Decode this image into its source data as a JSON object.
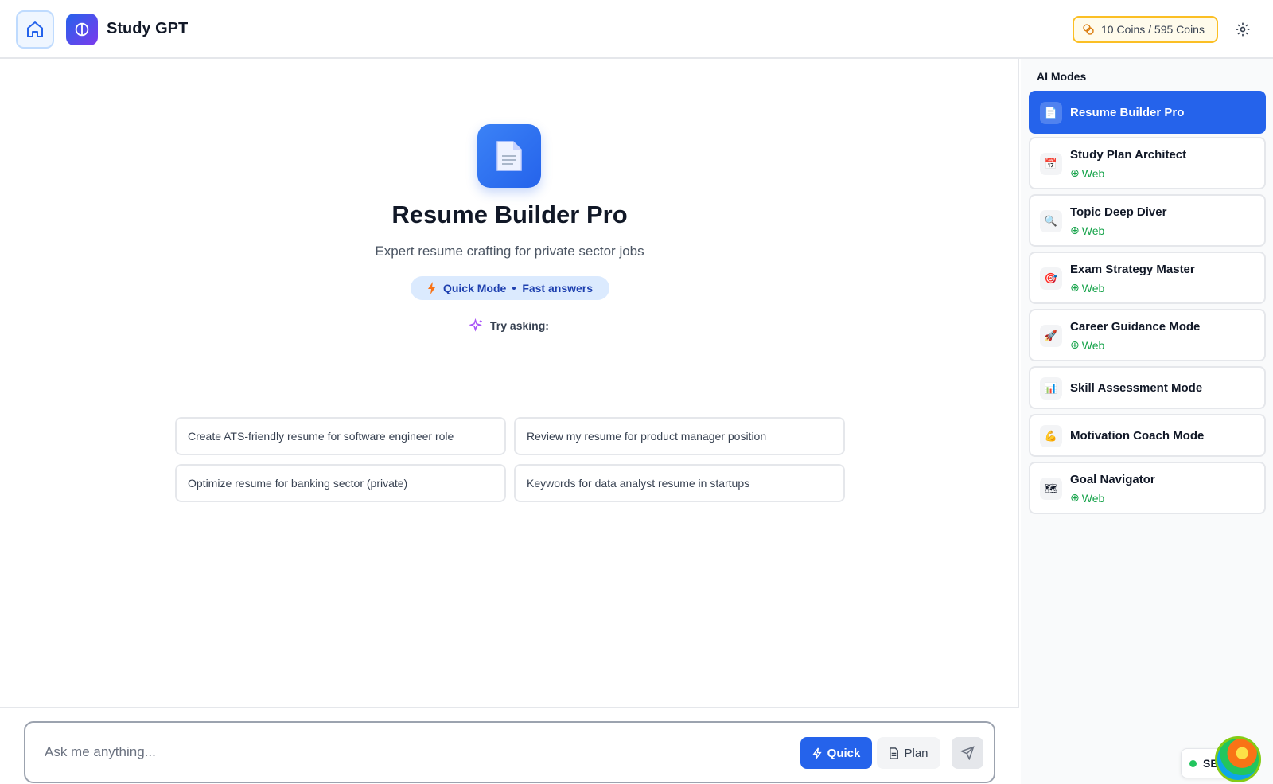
{
  "header": {
    "app_title": "Study GPT",
    "coins_label": "10 Coins / 595 Coins"
  },
  "hero": {
    "title": "Resume Builder Pro",
    "subtitle": "Expert resume crafting for private sector jobs",
    "mode_label": "Quick Mode",
    "mode_detail": "Fast answers"
  },
  "suggestions": {
    "heading": "Try asking:",
    "items": [
      "Create ATS-friendly resume for software engineer role",
      "Review my resume for product manager position",
      "Optimize resume for banking sector (private)",
      "Keywords for data analyst resume in startups"
    ]
  },
  "composer": {
    "placeholder": "Ask me anything...",
    "quick_label": "Quick",
    "plan_label": "Plan"
  },
  "sidebar": {
    "title": "AI Modes",
    "web_label": "Web",
    "modes": [
      {
        "label": "Resume Builder Pro",
        "icon": "document-icon",
        "active": true,
        "web": false
      },
      {
        "label": "Study Plan Architect",
        "icon": "calendar-icon",
        "active": false,
        "web": true
      },
      {
        "label": "Topic Deep Diver",
        "icon": "magnifier-icon",
        "active": false,
        "web": true
      },
      {
        "label": "Exam Strategy Master",
        "icon": "target-icon",
        "active": false,
        "web": true
      },
      {
        "label": "Career Guidance Mode",
        "icon": "rocket-icon",
        "active": false,
        "web": true
      },
      {
        "label": "Skill Assessment Mode",
        "icon": "bar-chart-icon",
        "active": false,
        "web": false
      },
      {
        "label": "Motivation Coach Mode",
        "icon": "flexed-arm-icon",
        "active": false,
        "web": false
      },
      {
        "label": "Goal Navigator",
        "icon": "map-icon",
        "active": false,
        "web": true
      }
    ]
  },
  "status": {
    "label": "SE"
  },
  "colors": {
    "primary": "#2563eb",
    "coins_border": "#fbbf24",
    "web_green": "#16a34a"
  }
}
